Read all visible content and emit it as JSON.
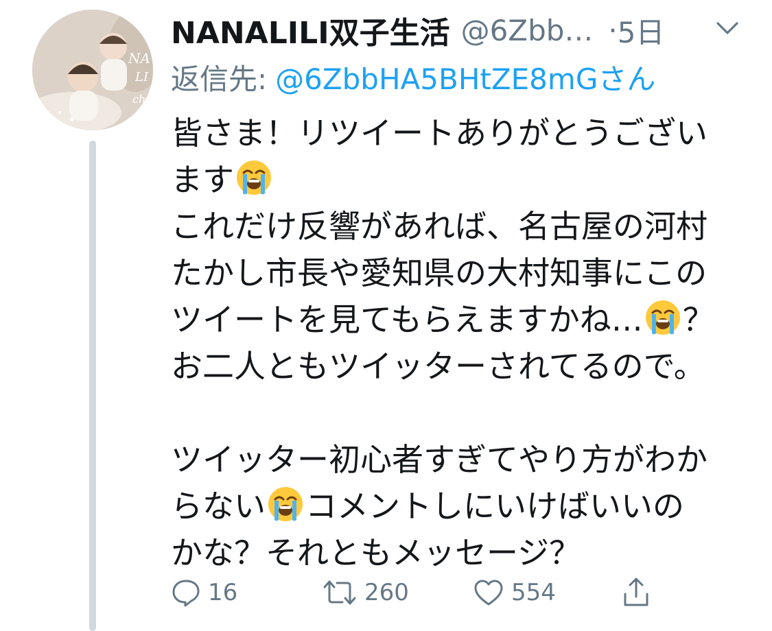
{
  "tweet": {
    "display_name": "NANALILI双子生活",
    "handle": "@6Zbb…",
    "separator": "·",
    "time": "5日",
    "reply_prefix": "返信先:",
    "reply_to": "@6ZbbHA5BHtZE8mGさん",
    "lines": [
      "皆さま！リツイートありがとうござい",
      "ます",
      "これだけ反響があれば、名古屋の河村",
      "たかし市長や愛知県の大村知事にこの",
      "ツイートを見てもらえますかね…",
      "？",
      "お二人ともツイッターされてるので。",
      "ツイッター初心者すぎてやり方がわか",
      "らない",
      "コメントしにいけばいいの",
      "かな？それともメッセージ？"
    ],
    "emoji_icon": "loudly-crying-face-icon",
    "replies": "16",
    "retweets": "260",
    "likes": "554"
  },
  "icons": {
    "reply": "speech-bubble-icon",
    "retweet": "retweet-icon",
    "like": "heart-icon",
    "share": "share-icon",
    "menu": "chevron-down-icon"
  },
  "colors": {
    "text": "#14171a",
    "muted": "#657786",
    "link": "#1da1f2",
    "thread_line": "#cfd9de"
  }
}
